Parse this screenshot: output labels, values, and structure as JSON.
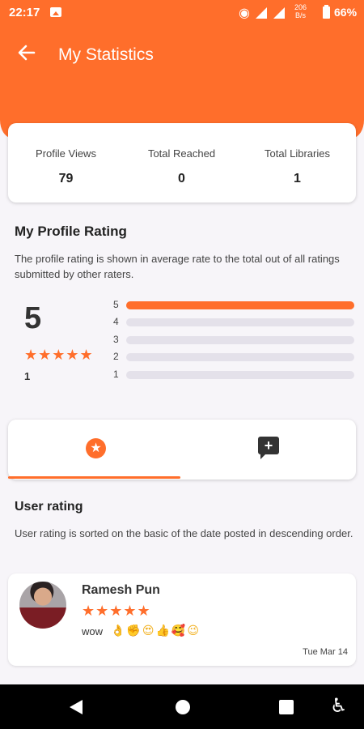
{
  "status_bar": {
    "time": "22:17",
    "network_speed": "206\nB/s",
    "battery": "66%"
  },
  "header": {
    "title": "My Statistics",
    "back_icon": "arrow-left-icon"
  },
  "stats": [
    {
      "label": "Profile Views",
      "value": "79"
    },
    {
      "label": "Total Reached",
      "value": "0"
    },
    {
      "label": "Total Libraries",
      "value": "1"
    }
  ],
  "profile_rating": {
    "title": "My Profile Rating",
    "description": "The profile rating is shown in average rate to the total out of all ratings submitted by other raters.",
    "average": "5",
    "stars": "★★★★★",
    "count": "1",
    "breakdown": [
      {
        "label": "5",
        "fill": 1.0
      },
      {
        "label": "4",
        "fill": 0.0
      },
      {
        "label": "3",
        "fill": 0.0
      },
      {
        "label": "2",
        "fill": 0.0
      },
      {
        "label": "1",
        "fill": 0.0
      }
    ]
  },
  "tabs": {
    "active": "ratings",
    "items": [
      "star-badge-icon",
      "comment-add-icon"
    ]
  },
  "user_rating": {
    "title": "User rating",
    "description": "User rating is sorted on the basic of the date posted in descending order."
  },
  "reviews": [
    {
      "name": "Ramesh Pun",
      "stars": "★★★★★",
      "text": "wow",
      "emoji": "👌✊😍👍🥰😉",
      "date": "Tue Mar 14"
    }
  ],
  "colors": {
    "accent": "#ff6e2b",
    "background": "#f7f5f9",
    "card": "#ffffff",
    "bar_track": "#e4e1ea"
  }
}
